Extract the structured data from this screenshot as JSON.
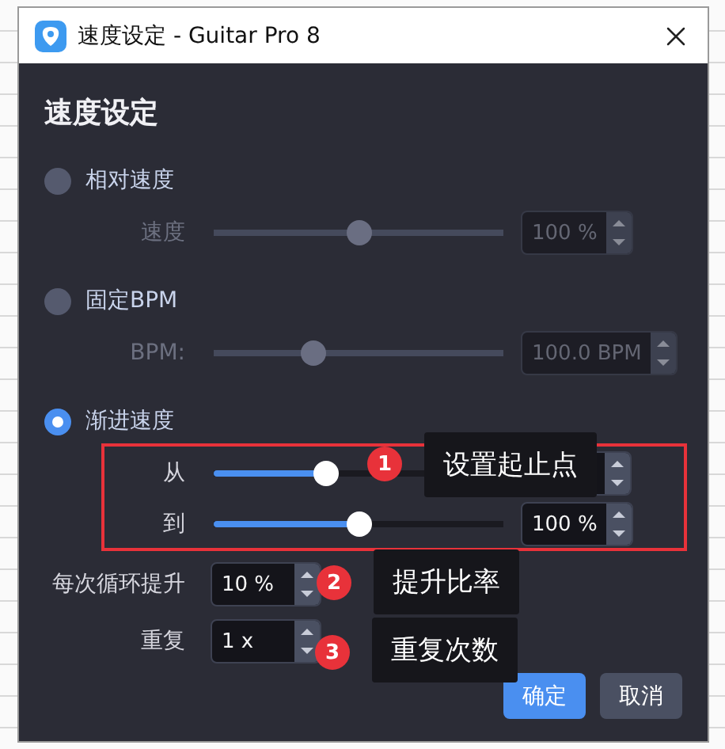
{
  "window": {
    "title": "速度设定 - Guitar Pro 8"
  },
  "heading": "速度设定",
  "modes": [
    {
      "label": "相对速度",
      "selected": false,
      "rows": [
        {
          "label": "速度",
          "level": 0.5,
          "value": "100 %"
        }
      ]
    },
    {
      "label": "固定BPM",
      "selected": false,
      "rows": [
        {
          "label": "BPM:",
          "level": 0.33,
          "value": "100.0 BPM"
        }
      ]
    },
    {
      "label": "渐进速度",
      "selected": true,
      "rows": [
        {
          "label": "从",
          "level": 0.38
        },
        {
          "label": "到",
          "level": 0.5,
          "value": "100 %"
        }
      ]
    }
  ],
  "steps": [
    {
      "label": "每次循环提升",
      "value": "10 %"
    },
    {
      "label": "重复",
      "value": "1 x"
    }
  ],
  "buttons": [
    {
      "label": "确定",
      "primary": true
    },
    {
      "label": "取消",
      "primary": false
    }
  ],
  "annotations": [
    {
      "number": "1",
      "text": "设置起止点"
    },
    {
      "number": "2",
      "text": "提升比率"
    },
    {
      "number": "3",
      "text": "重复次数"
    }
  ]
}
